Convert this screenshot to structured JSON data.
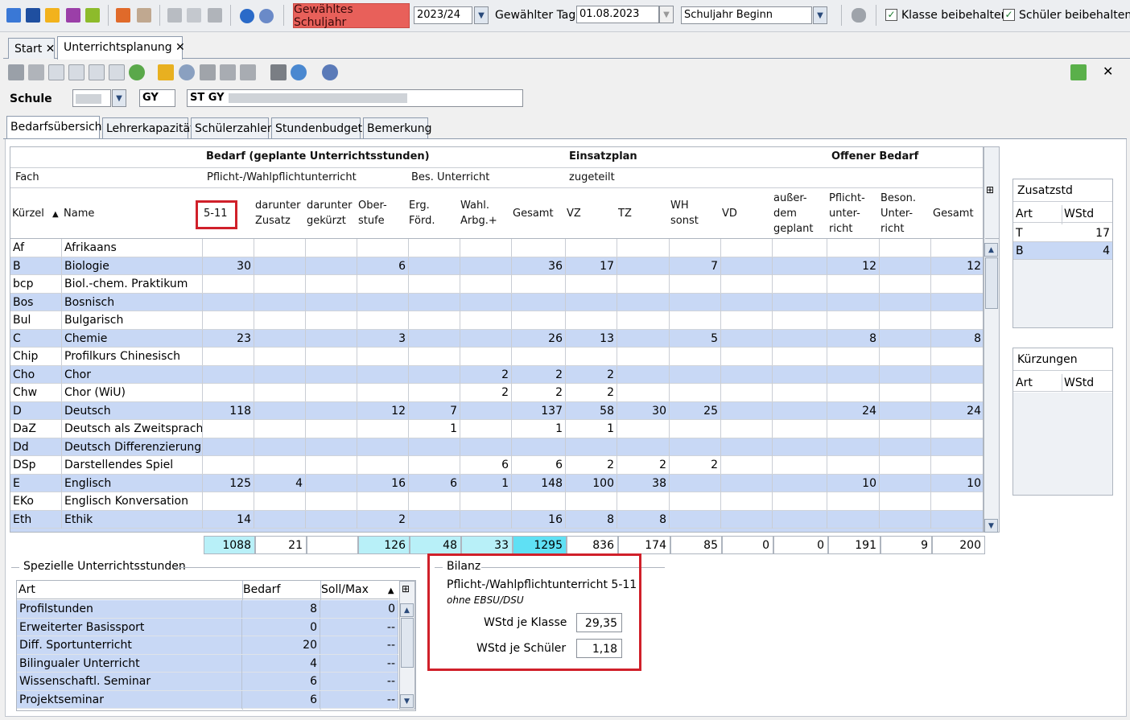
{
  "topbar": {
    "schuljahr_button": "Gewähltes Schuljahr",
    "schuljahr_value": "2023/24",
    "tag_label": "Gewählter Tag",
    "tag_value": "01.08.2023",
    "mode_value": "Schuljahr Beginn",
    "klasse_checkbox": "Klasse beibehalten",
    "schueler_checkbox": "Schüler beibehalten"
  },
  "tabs": [
    {
      "label": "Start",
      "close": "✕"
    },
    {
      "label": "Unterrichtsplanung",
      "close": "✕"
    }
  ],
  "close_panel": "✕",
  "schule": {
    "label": "Schule",
    "type_value": "GY",
    "name_value": "ST GY"
  },
  "subtabs": [
    "Bedarfsübersicht",
    "Lehrerkapazität",
    "Schülerzahlen",
    "Stundenbudget",
    "Bemerkung"
  ],
  "grid": {
    "group_headers": {
      "bedarf": "Bedarf (geplante Unterrichtsstunden)",
      "einsatzplan": "Einsatzplan",
      "offener": "Offener Bedarf"
    },
    "sub_headers": {
      "fach": "Fach",
      "pflicht": "Pflicht-/Wahlpflichtunterricht",
      "bes": "Bes. Unterricht",
      "zugeteilt": "zugeteilt"
    },
    "columns": {
      "kuerzel": "Kürzel",
      "sort_indicator": "▲",
      "name": "Name",
      "c511": "5-11",
      "zusatz_1": "darunter",
      "zusatz_2": "Zusatz",
      "gekuerzt_1": "darunter",
      "gekuerzt_2": "gekürzt",
      "ober_1": "Ober-",
      "ober_2": "stufe",
      "erg_1": "Erg.",
      "erg_2": "Förd.",
      "wahl_1": "Wahl.",
      "wahl_2": "Arbg.+",
      "gesamt": "Gesamt",
      "vz": "VZ",
      "tz": "TZ",
      "wh_1": "WH",
      "wh_2": "sonst",
      "vd": "VD",
      "ausser_1": "außer-",
      "ausser_2": "dem",
      "ausser_3": "geplant",
      "pfl_1": "Pflicht-",
      "pfl_2": "unter-",
      "pfl_3": "richt",
      "beson_1": "Beson.",
      "beson_2": "Unter-",
      "beson_3": "richt",
      "gesamt2": "Gesamt"
    },
    "rows": [
      [
        "Af",
        "Afrikaans",
        "",
        "",
        "",
        "",
        "",
        "",
        "",
        "",
        "",
        "",
        "",
        "",
        "",
        "",
        ""
      ],
      [
        "B",
        "Biologie",
        "30",
        "",
        "",
        "6",
        "",
        "",
        "36",
        "17",
        "",
        "7",
        "",
        "",
        "12",
        "",
        "12"
      ],
      [
        "bcp",
        "Biol.-chem. Praktikum",
        "",
        "",
        "",
        "",
        "",
        "",
        "",
        "",
        "",
        "",
        "",
        "",
        "",
        "",
        ""
      ],
      [
        "Bos",
        "Bosnisch",
        "",
        "",
        "",
        "",
        "",
        "",
        "",
        "",
        "",
        "",
        "",
        "",
        "",
        "",
        ""
      ],
      [
        "Bul",
        "Bulgarisch",
        "",
        "",
        "",
        "",
        "",
        "",
        "",
        "",
        "",
        "",
        "",
        "",
        "",
        "",
        ""
      ],
      [
        "C",
        "Chemie",
        "23",
        "",
        "",
        "3",
        "",
        "",
        "26",
        "13",
        "",
        "5",
        "",
        "",
        "8",
        "",
        "8"
      ],
      [
        "Chip",
        "Profilkurs Chinesisch",
        "",
        "",
        "",
        "",
        "",
        "",
        "",
        "",
        "",
        "",
        "",
        "",
        "",
        "",
        ""
      ],
      [
        "Cho",
        "Chor",
        "",
        "",
        "",
        "",
        "",
        "2",
        "2",
        "2",
        "",
        "",
        "",
        "",
        "",
        "",
        ""
      ],
      [
        "Chw",
        "Chor (WiU)",
        "",
        "",
        "",
        "",
        "",
        "2",
        "2",
        "2",
        "",
        "",
        "",
        "",
        "",
        "",
        ""
      ],
      [
        "D",
        "Deutsch",
        "118",
        "",
        "",
        "12",
        "7",
        "",
        "137",
        "58",
        "30",
        "25",
        "",
        "",
        "24",
        "",
        "24"
      ],
      [
        "DaZ",
        "Deutsch als Zweitsprache",
        "",
        "",
        "",
        "",
        "1",
        "",
        "1",
        "1",
        "",
        "",
        "",
        "",
        "",
        "",
        ""
      ],
      [
        "Dd",
        "Deutsch Differenzierung",
        "",
        "",
        "",
        "",
        "",
        "",
        "",
        "",
        "",
        "",
        "",
        "",
        "",
        "",
        ""
      ],
      [
        "DSp",
        "Darstellendes Spiel",
        "",
        "",
        "",
        "",
        "",
        "6",
        "6",
        "2",
        "2",
        "2",
        "",
        "",
        "",
        "",
        ""
      ],
      [
        "E",
        "Englisch",
        "125",
        "4",
        "",
        "16",
        "6",
        "1",
        "148",
        "100",
        "38",
        "",
        "",
        "",
        "10",
        "",
        "10"
      ],
      [
        "EKo",
        "Englisch Konversation",
        "",
        "",
        "",
        "",
        "",
        "",
        "",
        "",
        "",
        "",
        "",
        "",
        "",
        "",
        ""
      ],
      [
        "Eth",
        "Ethik",
        "14",
        "",
        "",
        "2",
        "",
        "",
        "16",
        "8",
        "8",
        "",
        "",
        "",
        "",
        "",
        ""
      ]
    ],
    "totals": [
      "1088",
      "21",
      "",
      "126",
      "48",
      "33",
      "1295",
      "836",
      "174",
      "85",
      "0",
      "0",
      "191",
      "9",
      "200"
    ]
  },
  "zusatzstd": {
    "title": "Zusatzstd",
    "col_art": "Art",
    "col_wstd": "WStd",
    "rows": [
      [
        "T",
        "17"
      ],
      [
        "B",
        "4"
      ]
    ]
  },
  "kuerzungen": {
    "title": "Kürzungen",
    "col_art": "Art",
    "col_wstd": "WStd"
  },
  "speziell": {
    "title": "Spezielle Unterrichtsstunden",
    "col_art": "Art",
    "col_bedarf": "Bedarf",
    "col_soll": "Soll/Max",
    "sort_indicator": "▲",
    "rows": [
      [
        "Profilstunden",
        "8",
        "0"
      ],
      [
        "Erweiterter Basissport",
        "0",
        "--"
      ],
      [
        "Diff. Sportunterricht",
        "20",
        "--"
      ],
      [
        "Bilingualer Unterricht",
        "4",
        "--"
      ],
      [
        "Wissenschaftl. Seminar",
        "6",
        "--"
      ],
      [
        "Projektseminar",
        "6",
        "--"
      ]
    ]
  },
  "bilanz": {
    "title": "Bilanz",
    "heading": "Pflicht-/Wahlpflichtunterricht 5-11",
    "subheading": "ohne EBSU/DSU",
    "klasse_label": "WStd je Klasse",
    "klasse_value": "29,35",
    "schueler_label": "WStd je Schüler",
    "schueler_value": "1,18"
  },
  "colors": {
    "highlight_red": "#d0202a",
    "row_blue": "#c8d8f5",
    "total_cyan": "#b8f0f8",
    "total_cyan_dark": "#5fe0f4",
    "schuljahr_red": "#e8605a"
  }
}
